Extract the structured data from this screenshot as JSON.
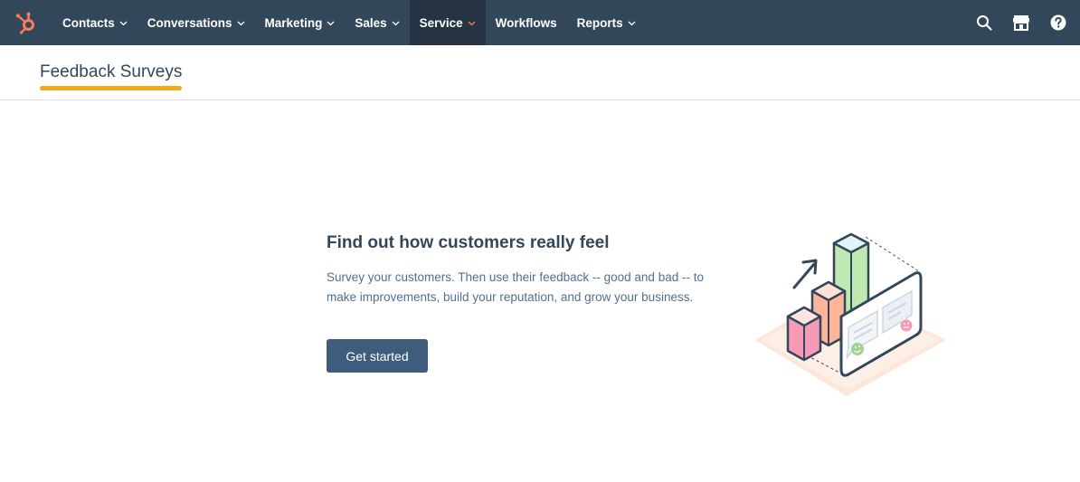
{
  "nav": {
    "items": [
      {
        "label": "Contacts",
        "has_caret": true,
        "active": false
      },
      {
        "label": "Conversations",
        "has_caret": true,
        "active": false
      },
      {
        "label": "Marketing",
        "has_caret": true,
        "active": false
      },
      {
        "label": "Sales",
        "has_caret": true,
        "active": false
      },
      {
        "label": "Service",
        "has_caret": true,
        "active": true
      },
      {
        "label": "Workflows",
        "has_caret": false,
        "active": false
      },
      {
        "label": "Reports",
        "has_caret": true,
        "active": false
      }
    ],
    "right_icons": [
      "search-icon",
      "marketplace-icon",
      "help-icon"
    ],
    "colors": {
      "bar": "#33475b",
      "active": "#253342",
      "active_caret": "#ff7a59",
      "logo": "#ff7a59"
    }
  },
  "header": {
    "title": "Feedback Surveys",
    "underline_color": "#f2a91c"
  },
  "empty_state": {
    "headline": "Find out how customers really feel",
    "body": "Survey your customers. Then use their feedback -- good and bad -- to make improvements, build your reputation, and grow your business.",
    "cta_label": "Get started",
    "illustration": "survey-chart-illustration"
  }
}
